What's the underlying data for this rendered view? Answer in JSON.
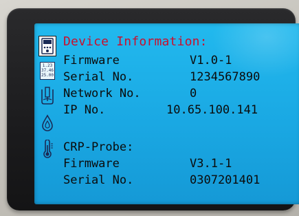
{
  "screen": {
    "title": "Device Information:",
    "device": {
      "rows": [
        {
          "label": "Firmware",
          "value": "V1.0-1"
        },
        {
          "label": "Serial No.",
          "value": "1234567890"
        },
        {
          "label": "Network No.",
          "value": "0"
        },
        {
          "label": "IP No.",
          "value": "10.65.100.141"
        }
      ]
    },
    "probe": {
      "title": "CRP-Probe:",
      "rows": [
        {
          "label": "Firmware",
          "value": "V3.1-1"
        },
        {
          "label": "Serial No.",
          "value": "0307201401"
        }
      ]
    }
  },
  "sidebar": {
    "icons": [
      {
        "name": "device-info-icon",
        "active": true
      },
      {
        "name": "measurement-values-icon",
        "values": [
          "1.23",
          "37.46",
          "25.00"
        ]
      },
      {
        "name": "sensor-probe-icon"
      },
      {
        "name": "water-drop-icon"
      },
      {
        "name": "thermometer-icon"
      }
    ]
  },
  "colors": {
    "screen_background": "#1aa8e3",
    "title_text": "#c8102e",
    "body_text": "#0b0b0b",
    "bezel": "#1b1b1d"
  }
}
